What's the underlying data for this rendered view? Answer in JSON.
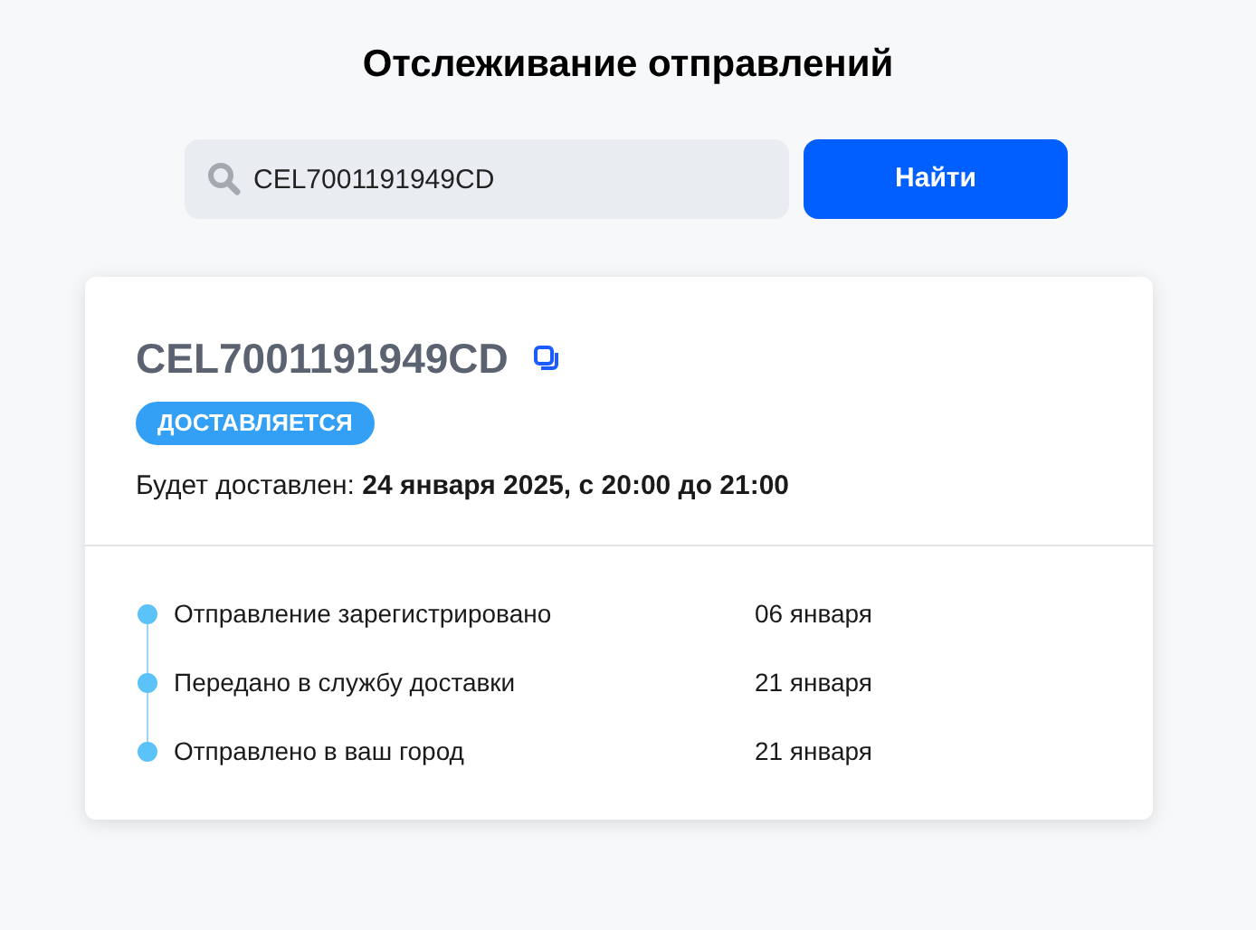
{
  "page": {
    "title": "Отслеживание отправлений"
  },
  "search": {
    "value": "CEL7001191949CD",
    "button": "Найти"
  },
  "shipment": {
    "tracking_number": "CEL7001191949CD",
    "status": "ДОСТАВЛЯЕТСЯ",
    "delivery": "Будет доставлен: **24 января 2025, с 20:00 до 21:00**",
    "events": [
      {
        "label": "Отправление зарегистрировано",
        "date": "06 января"
      },
      {
        "label": "Передано в службу доставки",
        "date": "21 января"
      },
      {
        "label": "Отправлено в ваш город",
        "date": "21 января"
      }
    ]
  }
}
